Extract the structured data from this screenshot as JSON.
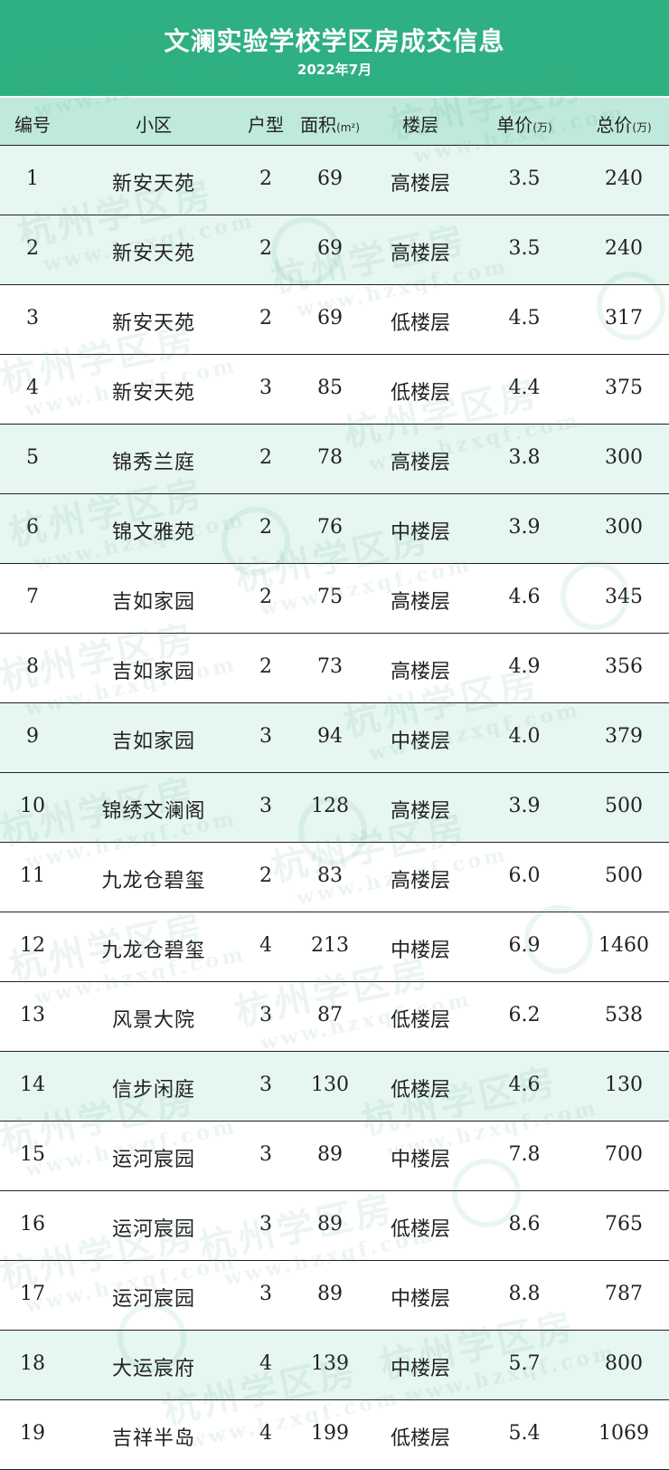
{
  "header": {
    "title": "文澜实验学校学区房成交信息",
    "subtitle": "2022年7月"
  },
  "table": {
    "columns": [
      {
        "label": "编号",
        "unit": ""
      },
      {
        "label": "小区",
        "unit": ""
      },
      {
        "label": "户型",
        "unit": ""
      },
      {
        "label": "面积",
        "unit": "(m²)"
      },
      {
        "label": "楼层",
        "unit": ""
      },
      {
        "label": "单价",
        "unit": "(万)"
      },
      {
        "label": "总价",
        "unit": "(万)"
      }
    ],
    "rows": [
      [
        "1",
        "新安天苑",
        "2",
        "69",
        "高楼层",
        "3.5",
        "240"
      ],
      [
        "2",
        "新安天苑",
        "2",
        "69",
        "高楼层",
        "3.5",
        "240"
      ],
      [
        "3",
        "新安天苑",
        "2",
        "69",
        "低楼层",
        "4.5",
        "317"
      ],
      [
        "4",
        "新安天苑",
        "3",
        "85",
        "低楼层",
        "4.4",
        "375"
      ],
      [
        "5",
        "锦秀兰庭",
        "2",
        "78",
        "高楼层",
        "3.8",
        "300"
      ],
      [
        "6",
        "锦文雅苑",
        "2",
        "76",
        "中楼层",
        "3.9",
        "300"
      ],
      [
        "7",
        "吉如家园",
        "2",
        "75",
        "高楼层",
        "4.6",
        "345"
      ],
      [
        "8",
        "吉如家园",
        "2",
        "73",
        "高楼层",
        "4.9",
        "356"
      ],
      [
        "9",
        "吉如家园",
        "3",
        "94",
        "中楼层",
        "4.0",
        "379"
      ],
      [
        "10",
        "锦绣文澜阁",
        "3",
        "128",
        "高楼层",
        "3.9",
        "500"
      ],
      [
        "11",
        "九龙仓碧玺",
        "2",
        "83",
        "高楼层",
        "6.0",
        "500"
      ],
      [
        "12",
        "九龙仓碧玺",
        "4",
        "213",
        "中楼层",
        "6.9",
        "1460"
      ],
      [
        "13",
        "风景大院",
        "3",
        "87",
        "低楼层",
        "6.2",
        "538"
      ],
      [
        "14",
        "信步闲庭",
        "3",
        "130",
        "低楼层",
        "4.6",
        "130"
      ],
      [
        "15",
        "运河宸园",
        "3",
        "89",
        "中楼层",
        "7.8",
        "700"
      ],
      [
        "16",
        "运河宸园",
        "3",
        "89",
        "低楼层",
        "8.6",
        "765"
      ],
      [
        "17",
        "运河宸园",
        "3",
        "89",
        "中楼层",
        "8.8",
        "787"
      ],
      [
        "18",
        "大运宸府",
        "4",
        "139",
        "中楼层",
        "5.7",
        "800"
      ],
      [
        "19",
        "吉祥半岛",
        "4",
        "199",
        "低楼层",
        "5.4",
        "1069"
      ]
    ],
    "alt_rows": [
      1,
      2,
      5,
      6,
      9,
      10,
      14,
      18
    ]
  },
  "watermark": {
    "text": "杭州学区房",
    "url": "www.hzxqf.com"
  },
  "colors": {
    "header_bg": "#2fb082",
    "header_row_bg": "#bfe9da",
    "alt_row_bg": "#e6f6f0"
  }
}
